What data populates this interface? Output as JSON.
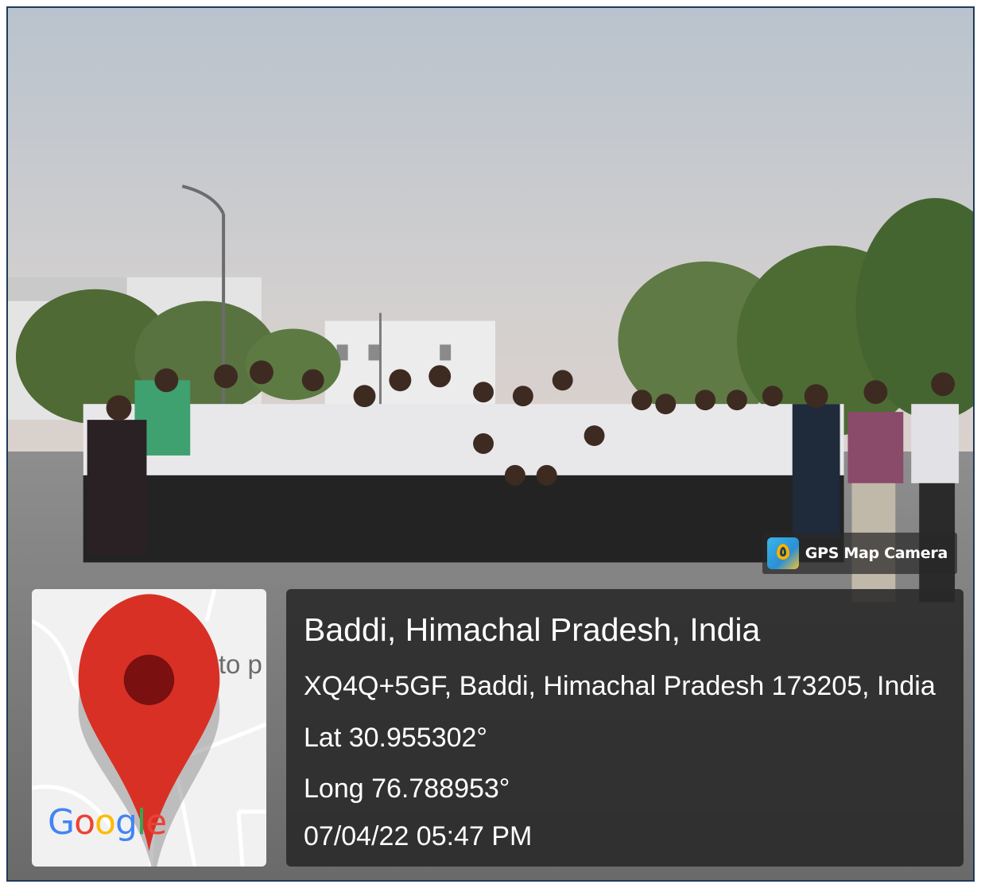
{
  "photo": {
    "description_icon": "group-photo"
  },
  "badge": {
    "icon": "gps-map-camera-icon",
    "label": "GPS Map Camera"
  },
  "map": {
    "place_label": "Aristo p",
    "logo_text": "Google",
    "pin_icon": "map-pin-icon",
    "pin_color": "#d93025"
  },
  "location": {
    "title": "Baddi, Himachal Pradesh, India",
    "address": "XQ4Q+5GF, Baddi, Himachal Pradesh 173205, India",
    "latitude": "Lat 30.955302°",
    "longitude": "Long 76.788953°",
    "datetime": "07/04/22 05:47 PM"
  },
  "colors": {
    "frame_border": "#1f3a5a",
    "info_bg": "#282828",
    "map_bg": "#f1f1f1"
  }
}
